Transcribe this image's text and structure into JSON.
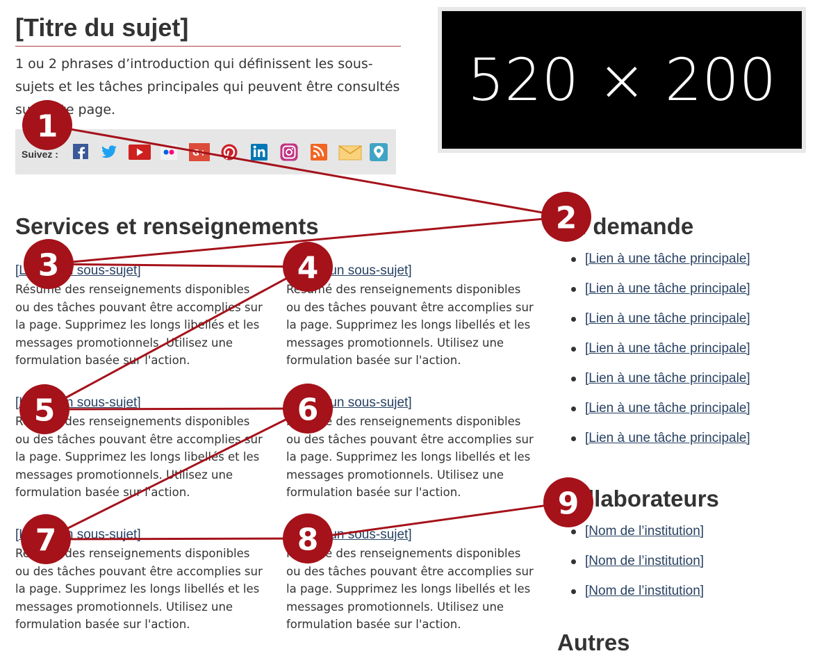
{
  "header": {
    "title": "[Titre du sujet]",
    "intro": "1 ou 2 phrases d’introduction qui définissent les sous-sujets et les tâches principales qui peuvent être consultés sur cette page."
  },
  "follow": {
    "label": "Suivez :",
    "icons": [
      "facebook-icon",
      "twitter-icon",
      "youtube-icon",
      "flickr-icon",
      "google-plus-icon",
      "pinterest-icon",
      "linkedin-icon",
      "instagram-icon",
      "rss-icon",
      "email-icon",
      "periscope-icon"
    ]
  },
  "image": {
    "label": "520 × 200"
  },
  "services": {
    "heading": "Services et renseignements",
    "cards": [
      {
        "link": "[Lien à un sous-sujet]",
        "text": "Résumé des renseignements disponibles ou des tâches pouvant être accomplies sur la page. Supprimez les longs libellés et les messages promotionnels. Utilisez une formulation basée sur l'action."
      },
      {
        "link": "[Lien à un sous-sujet]",
        "text": "Résumé des renseignements disponibles ou des tâches pouvant être accomplies sur la page. Supprimez les longs libellés et les messages promotionnels. Utilisez une formulation basée sur l'action."
      },
      {
        "link": "[Lien à un sous-sujet]",
        "text": "Résumé des renseignements disponibles ou des tâches pouvant être accomplies sur la page. Supprimez les longs libellés et les messages promotionnels. Utilisez une formulation basée sur l'action."
      },
      {
        "link": "[Lien à un sous-sujet]",
        "text": "Résumé des renseignements disponibles ou des tâches pouvant être accomplies sur la page. Supprimez les longs libellés et les messages promotionnels. Utilisez une formulation basée sur l'action."
      },
      {
        "link": "[Lien à un sous-sujet]",
        "text": "Résumé des renseignements disponibles ou des tâches pouvant être accomplies sur la page. Supprimez les longs libellés et les messages promotionnels. Utilisez une formulation basée sur l'action."
      },
      {
        "link": "[Lien à un sous-sujet]",
        "text": "Résumé des renseignements disponibles ou des tâches pouvant être accomplies sur la page. Supprimez les longs libellés et les messages promotionnels. Utilisez une formulation basée sur l'action."
      }
    ]
  },
  "sidebar": {
    "demand": {
      "heading": "En demande",
      "items": [
        "[Lien à une tâche principale]",
        "[Lien à une tâche principale]",
        "[Lien à une tâche principale]",
        "[Lien à une tâche principale]",
        "[Lien à une tâche principale]",
        "[Lien à une tâche principale]",
        "[Lien à une tâche principale]"
      ]
    },
    "partners": {
      "heading": "Collaborateurs",
      "items": [
        "[Nom de l’institution]",
        "[Nom de l’institution]",
        "[Nom de l’institution]"
      ]
    },
    "others": {
      "heading": "Autres"
    }
  },
  "annotations": {
    "badges": [
      "1",
      "2",
      "3",
      "4",
      "5",
      "6",
      "7",
      "8",
      "9"
    ]
  },
  "colors": {
    "annotation": "#a5121a",
    "link": "#284162",
    "title_rule": "#af3c43",
    "follow_bar": "#e6e6e6"
  }
}
